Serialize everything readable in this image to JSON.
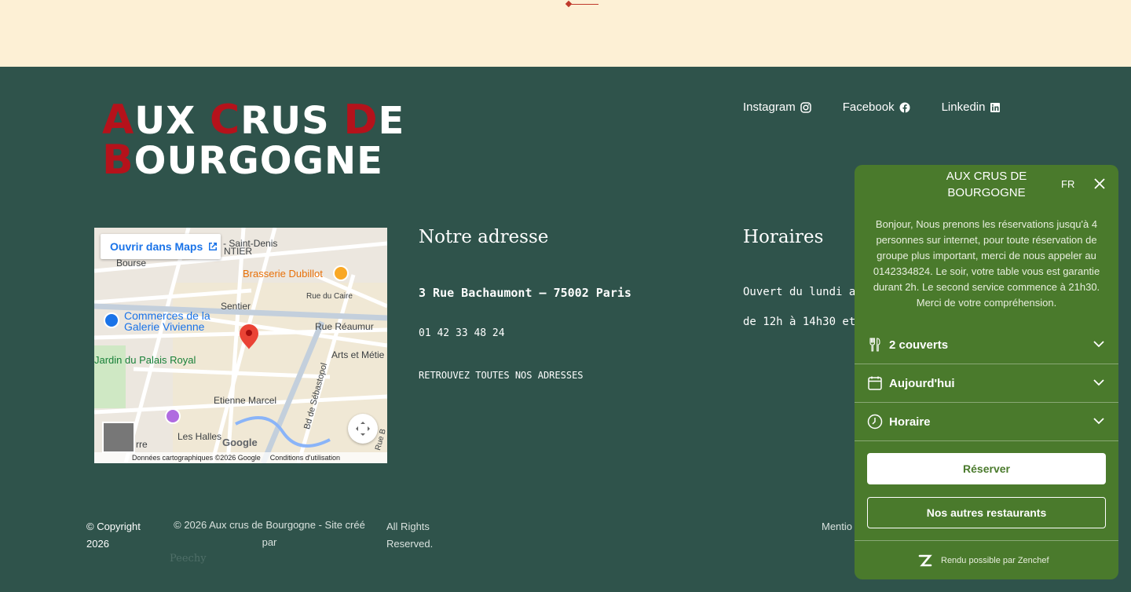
{
  "logo": {
    "line1": [
      "A",
      "UX ",
      "C",
      "RUS ",
      "D",
      "E"
    ],
    "line2": [
      "B",
      "OURGOGNE"
    ]
  },
  "socials": [
    {
      "label": "Instagram",
      "icon": "instagram-icon"
    },
    {
      "label": "Facebook",
      "icon": "facebook-icon"
    },
    {
      "label": "Linkedin",
      "icon": "linkedin-icon"
    }
  ],
  "map": {
    "open_button": "Ouvrir dans Maps",
    "labels": {
      "strasbourg": "Strasbourg - Saint-Denis",
      "ntier": "NTIER",
      "bourse": "Bourse",
      "brasserie": "Brasserie Dubillot",
      "sentier": "Sentier",
      "rue_caire": "Rue du Caire",
      "commerces": "Commerces de la",
      "galerie": "Galerie Vivienne",
      "rue_reaumur": "Rue Réaumur",
      "arts": "Arts et Métie",
      "jardin": "Jardin du Palais Royal",
      "etienne": "Etienne Marcel",
      "sebastopol": "Bd de Sébastopol",
      "halles": "Les Halles",
      "rue_b": "Rue B",
      "rre": "rre",
      "google": "Google"
    },
    "footer_data": "Données cartographiques ©2026 Google",
    "footer_terms": "Conditions d'utilisation"
  },
  "address": {
    "title": "Notre adresse",
    "street": "3 Rue Bachaumont – 75002 Paris",
    "phone": "01 42 33 48 24",
    "link": "RETROUVEZ TOUTES NOS ADRESSES"
  },
  "hours": {
    "title": "Horaires",
    "line1": "Ouvert du lundi a",
    "line2": "de 12h à 14h30 et"
  },
  "footer": {
    "copyright": "© Copyright",
    "year": "2026",
    "site_line1": "© 2026 Aux crus de Bourgogne - Site créé",
    "site_line2": "par",
    "agency": "Peechy",
    "rights1": "All Rights",
    "rights2": "Reserved.",
    "mentions": "Mentio"
  },
  "widget": {
    "title_line1": "AUX CRUS DE",
    "title_line2": "BOURGOGNE",
    "lang": "FR",
    "description": "Bonjour, Nous prenons les réservations jusqu'à 4 personnes sur internet, pour toute réservation de groupe plus important, merci de nous appeler au 0142334824. Le soir, votre table vous est garantie durant 2h. Le second service commence à 21h30. Merci de votre compréhension.",
    "guests": "2 couverts",
    "date": "Aujourd'hui",
    "time": "Horaire",
    "reserve": "Réserver",
    "other": "Nos autres restaurants",
    "powered": "Rendu possible par Zenchef"
  },
  "colors": {
    "footer_bg": "#2f534b",
    "top_bg": "#fdf0d5",
    "accent_red": "#b5121b",
    "widget_green": "#4a7a2c"
  }
}
